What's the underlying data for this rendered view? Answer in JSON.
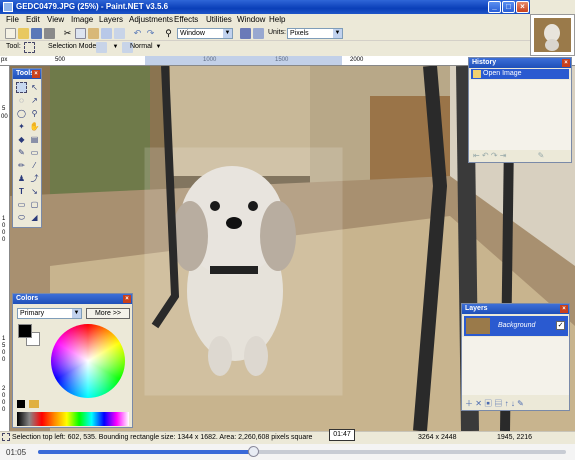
{
  "window": {
    "title": "GEDC0479.JPG (25%) - Paint.NET v3.5.6"
  },
  "menu": [
    "File",
    "Edit",
    "View",
    "Image",
    "Layers",
    "Adjustments",
    "Effects",
    "Utilities",
    "Window",
    "Help"
  ],
  "toolbar": {
    "zoom_value": "Window",
    "units_label": "Units:",
    "units_value": "Pixels"
  },
  "toolbar2": {
    "tool_label": "Tool:",
    "selection_mode_label": "Selection Mode:",
    "blend_value": "Normal"
  },
  "ruler": {
    "horizontal_labels": [
      "px",
      "500",
      "1000",
      "1500",
      "2000"
    ],
    "vertical_labels": [
      "5",
      "00",
      "1",
      "0",
      "0",
      "0",
      "1",
      "5",
      "0",
      "0",
      "2",
      "0",
      "0",
      "0"
    ]
  },
  "panels": {
    "tools_title": "Tools",
    "history_title": "History",
    "history_items": [
      "Open Image"
    ],
    "colors_title": "Colors",
    "colors_select": "Primary",
    "colors_more": "More >>",
    "layers_title": "Layers",
    "layer_name": "Background"
  },
  "status": {
    "selection_text": "Selection top left: 602, 535. Bounding rectangle size: 1344 x 1682. Area: 2,260,608 pixels square",
    "image_size": "3264 x 2448",
    "cursor_pos": "1945, 2216"
  },
  "media": {
    "current_time": "01:05",
    "hover_time": "01:47",
    "progress": 0.41
  },
  "colors": {
    "accent": "#0a3fb8",
    "primary_color": "#000000",
    "secondary_color": "#ffffff"
  }
}
